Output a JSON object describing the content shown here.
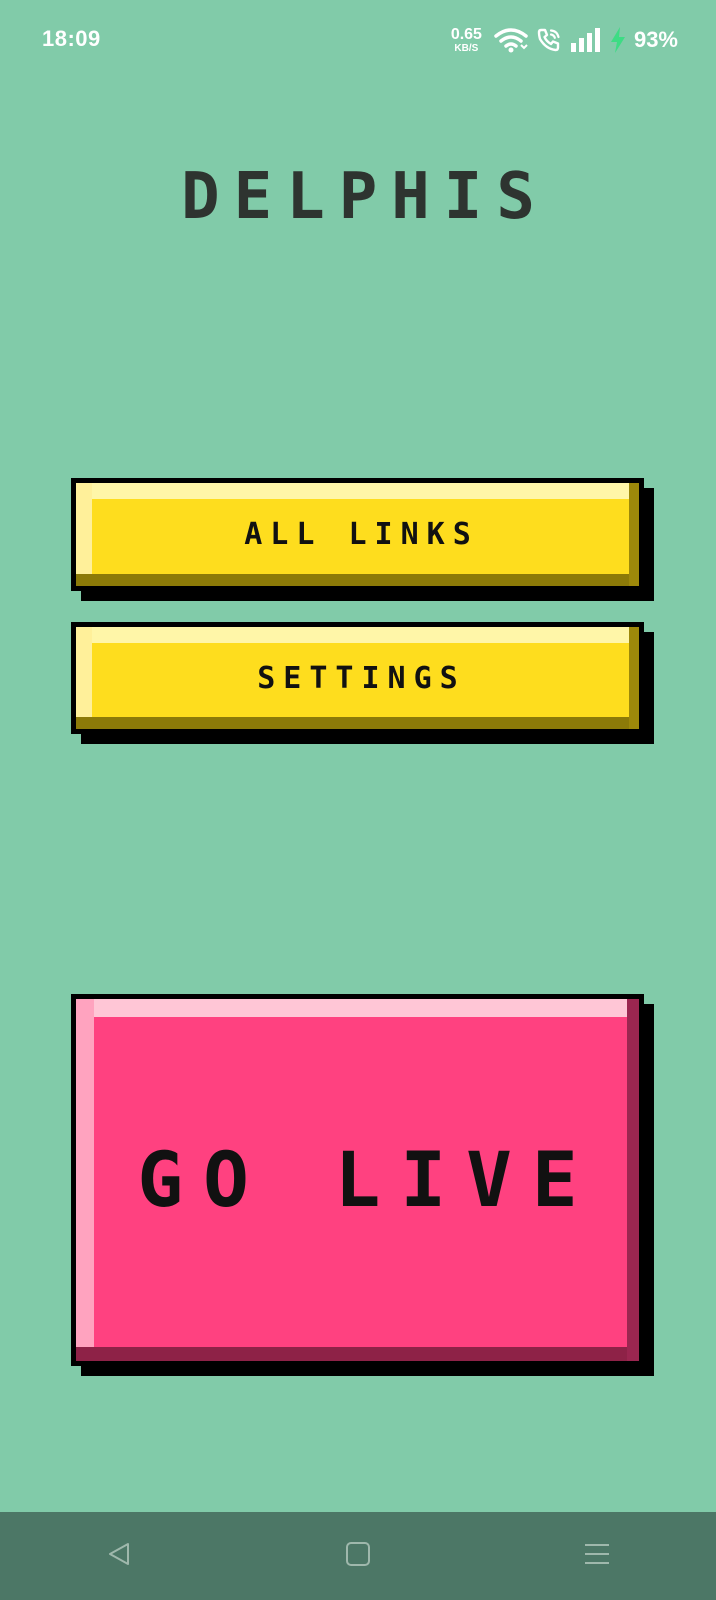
{
  "status_bar": {
    "time": "18:09",
    "net_speed_value": "0.65",
    "net_speed_unit": "KB/S",
    "battery_percent": "93%",
    "icons": [
      "wifi-icon",
      "wifi-calling-icon",
      "signal-icon",
      "charging-bolt-icon"
    ]
  },
  "app": {
    "title": "DELPHIS"
  },
  "menu": {
    "all_links_label": "ALL LINKS",
    "settings_label": "SETTINGS",
    "go_live_label": "GO LIVE"
  },
  "nav_bar": {
    "icons": [
      "back-icon",
      "home-icon",
      "recents-icon"
    ]
  },
  "colors": {
    "background": "#81cba9",
    "button_yellow": "#fedd1e",
    "button_pink": "#ff4180",
    "title_text": "#2e3430",
    "nav_bar": "#4c7766"
  }
}
